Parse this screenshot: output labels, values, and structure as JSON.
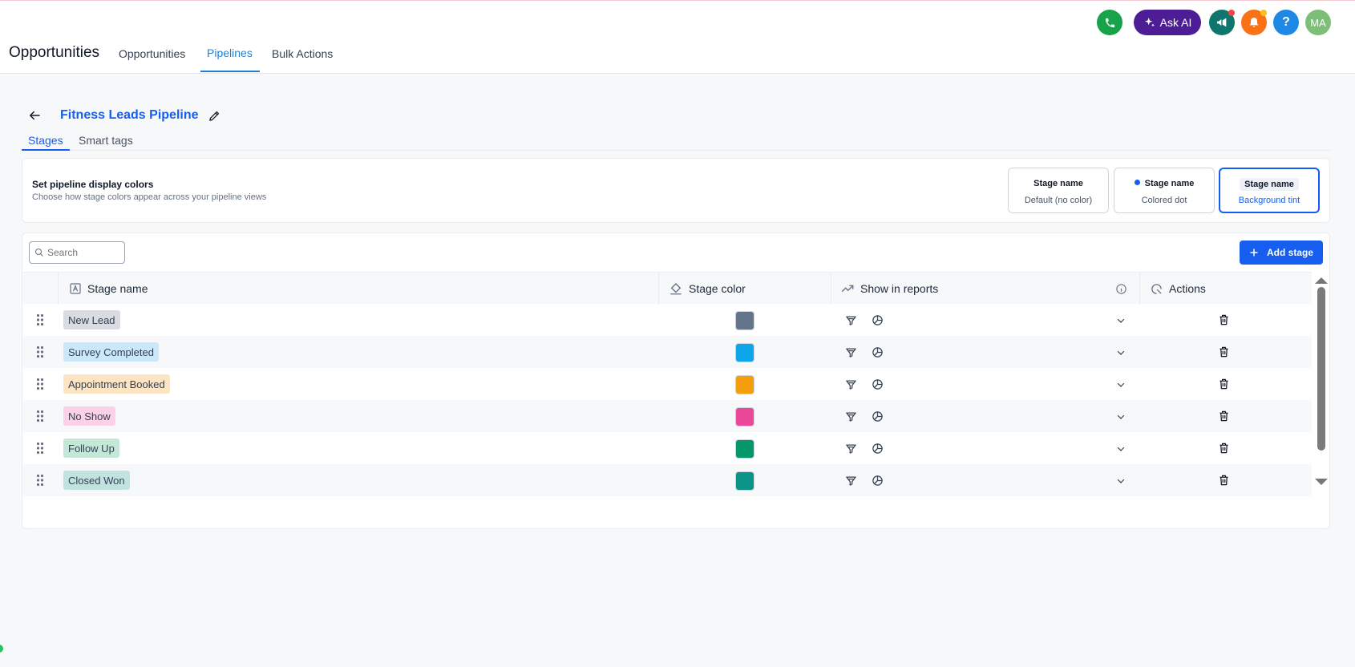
{
  "header": {
    "app_title": "Opportunities",
    "tabs": [
      {
        "label": "Opportunities",
        "active": false
      },
      {
        "label": "Pipelines",
        "active": true
      },
      {
        "label": "Bulk Actions",
        "active": false
      }
    ],
    "ask_ai_label": "Ask AI",
    "help_label": "?",
    "avatar_initials": "MA"
  },
  "pipeline": {
    "title": "Fitness Leads Pipeline",
    "tabs": [
      {
        "label": "Stages",
        "active": true
      },
      {
        "label": "Smart tags",
        "active": false
      }
    ]
  },
  "display_colors": {
    "title": "Set pipeline display colors",
    "description": "Choose how stage colors appear across your pipeline views",
    "options": [
      {
        "name": "Stage name",
        "sub": "Default (no color)",
        "selected": false
      },
      {
        "name": "Stage name",
        "sub": "Colored dot",
        "selected": false
      },
      {
        "name": "Stage name",
        "sub": "Background tint",
        "selected": true
      }
    ]
  },
  "table": {
    "search_placeholder": "Search",
    "add_stage_label": "Add stage",
    "columns": {
      "stage_name": "Stage name",
      "stage_color": "Stage color",
      "show_in_reports": "Show in reports",
      "actions": "Actions"
    },
    "rows": [
      {
        "name": "New Lead",
        "color": "#64748b",
        "tint": "#d9dde3"
      },
      {
        "name": "Survey Completed",
        "color": "#0ea5e9",
        "tint": "#cbe8f8"
      },
      {
        "name": "Appointment Booked",
        "color": "#f59e0b",
        "tint": "#fde5c3"
      },
      {
        "name": "No Show",
        "color": "#ec4899",
        "tint": "#fad1e6"
      },
      {
        "name": "Follow Up",
        "color": "#059669",
        "tint": "#c3e8d8"
      },
      {
        "name": "Closed Won",
        "color": "#0d9488",
        "tint": "#c1e3e0"
      }
    ]
  },
  "colors": {
    "accent": "#155eef",
    "nav_active": "#1d7fd6",
    "phone": "#16a34a",
    "ask_ai": "#4c1d95",
    "megaphone": "#0f766e",
    "bell": "#f97316",
    "help": "#1e88e5",
    "avatar": "#7dbf78"
  }
}
